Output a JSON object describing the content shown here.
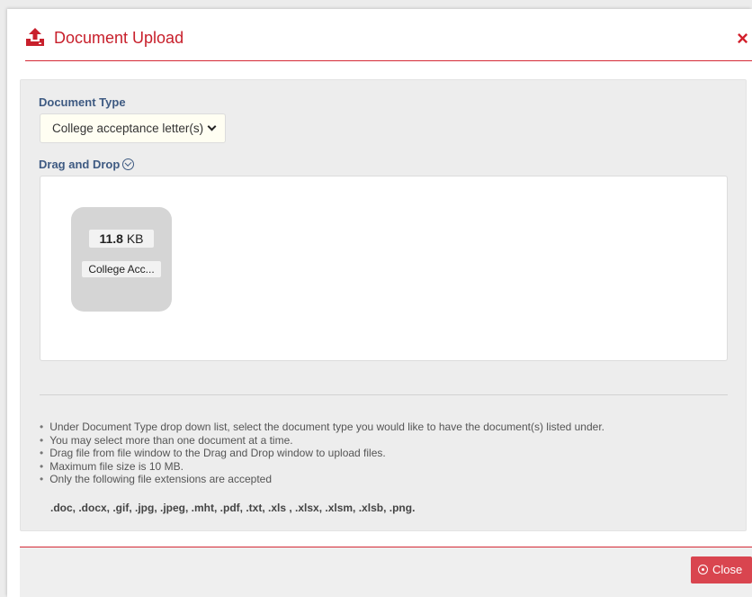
{
  "modal": {
    "title": "Document Upload",
    "close_symbol": "×",
    "header_icon": "upload-icon",
    "accent_color": "#c8202c"
  },
  "document_type": {
    "label": "Document Type",
    "selected": "College acceptance letter(s)"
  },
  "drag_drop": {
    "label": "Drag and Drop",
    "label_icon": "info-icon",
    "files": [
      {
        "size_value": "11.8",
        "size_unit": "KB",
        "name": "College Acc..."
      }
    ]
  },
  "instructions": [
    "Under Document Type drop down list, select the document type you would like to have the document(s) listed under.",
    "You may select more than one document at a time.",
    "Drag file from file window to the Drag and Drop window to upload files.",
    "Maximum file size is 10 MB.",
    "Only the following file extensions are accepted"
  ],
  "extensions": ".doc, .docx, .gif, .jpg, .jpeg, .mht, .pdf, .txt, .xls , .xlsx, .xlsm, .xlsb, .png.",
  "footer": {
    "close_label": "Close",
    "close_icon": "close-circle-icon"
  }
}
